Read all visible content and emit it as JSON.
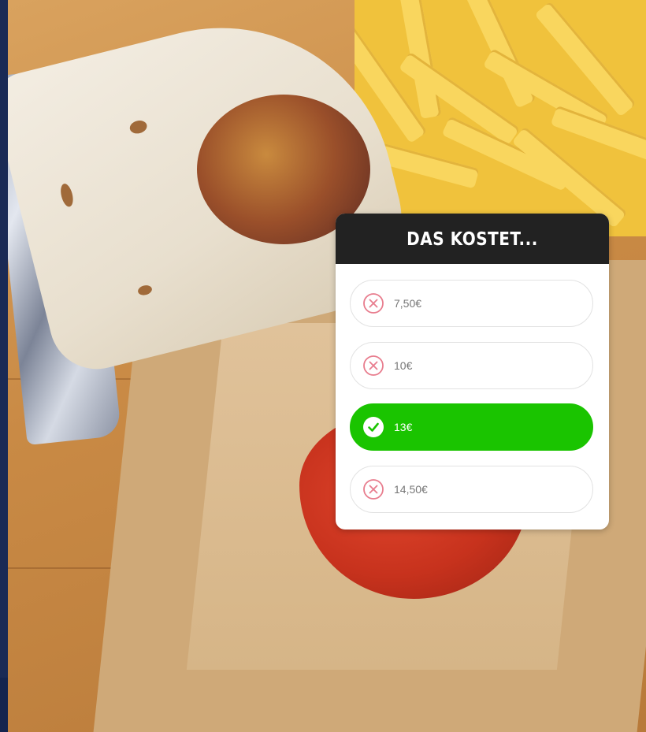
{
  "quiz": {
    "title": "DAS KOSTET...",
    "options": [
      {
        "label": "7,50€",
        "state": "wrong",
        "icon": "x-circle-icon"
      },
      {
        "label": "10€",
        "state": "wrong",
        "icon": "x-circle-icon"
      },
      {
        "label": "13€",
        "state": "correct",
        "icon": "check-circle-icon"
      },
      {
        "label": "14,50€",
        "state": "wrong",
        "icon": "x-circle-icon"
      }
    ]
  },
  "colors": {
    "header_bg": "#222222",
    "correct": "#1ac400",
    "wrong_icon": "#e87d8e",
    "option_border": "#e2e2e2"
  }
}
